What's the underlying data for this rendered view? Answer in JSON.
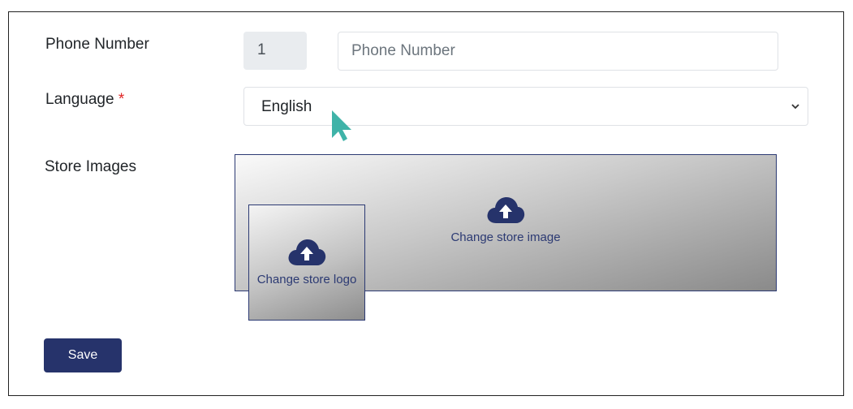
{
  "form": {
    "phone_label": "Phone Number",
    "phone_prefix": "1",
    "phone_placeholder": "Phone Number",
    "language_label": "Language",
    "required_mark": "*",
    "language_value": "English",
    "store_images_label": "Store Images",
    "change_store_image": "Change store image",
    "change_store_logo": "Change store logo",
    "save_label": "Save"
  },
  "icons": {
    "upload": "cloud-upload-icon",
    "select_arrow": "chevron-down-icon",
    "cursor": "mouse-cursor"
  },
  "colors": {
    "primary": "#26336b",
    "required": "#e02424",
    "cursor": "#3fb3a8"
  }
}
